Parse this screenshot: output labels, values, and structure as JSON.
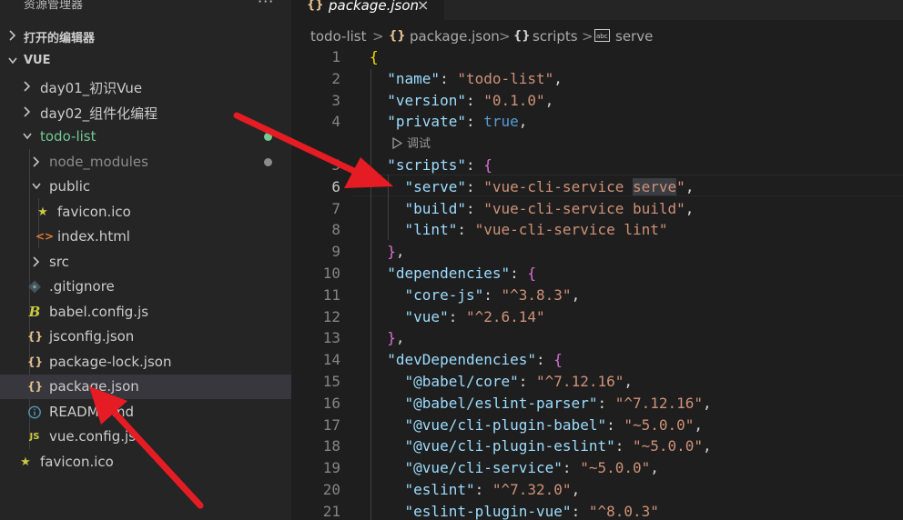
{
  "explorer": {
    "title": "资源管理器",
    "more_label": "···",
    "open_editors_label": "打开的编辑器",
    "workspace_label": "VUE"
  },
  "tree": [
    {
      "label": "day01_初识Vue",
      "icon": "chevron-right-icon",
      "kind": "folder"
    },
    {
      "label": "day02_组件化编程",
      "icon": "chevron-right-icon",
      "kind": "folder"
    },
    {
      "label": "todo-list",
      "icon": "chevron-down-icon",
      "kind": "folder",
      "color": "#73c991"
    },
    {
      "label": "node_modules",
      "icon": "chevron-right-icon",
      "kind": "folder",
      "color": "#8c8c8c"
    },
    {
      "label": "public",
      "icon": "chevron-down-icon",
      "kind": "folder"
    },
    {
      "label": "favicon.ico",
      "icon": "star-icon",
      "kind": "file"
    },
    {
      "label": "index.html",
      "icon": "html-icon",
      "kind": "file"
    },
    {
      "label": "src",
      "icon": "chevron-right-icon",
      "kind": "folder"
    },
    {
      "label": ".gitignore",
      "icon": "git-icon",
      "kind": "file"
    },
    {
      "label": "babel.config.js",
      "icon": "babel-icon",
      "kind": "file"
    },
    {
      "label": "jsconfig.json",
      "icon": "json-icon",
      "kind": "file"
    },
    {
      "label": "package-lock.json",
      "icon": "json-icon",
      "kind": "file"
    },
    {
      "label": "package.json",
      "icon": "json-icon",
      "kind": "file"
    },
    {
      "label": "README.md",
      "icon": "info-icon",
      "kind": "file"
    },
    {
      "label": "vue.config.js",
      "icon": "js-icon",
      "kind": "file"
    },
    {
      "label": "favicon.ico",
      "icon": "star-icon",
      "kind": "file"
    }
  ],
  "icons": {
    "json_glyph": "{}",
    "js_glyph": "JS",
    "babel_glyph": "B",
    "html_glyph": "<>",
    "info_glyph": "i",
    "star_glyph": "★"
  },
  "colors": {
    "json": "#e2c08d",
    "js": "#cbcb41",
    "html": "#e37933",
    "info": "#519aba",
    "star": "#cbcb41",
    "git": "#41535b",
    "modified_dot": "#73c991",
    "ignored_dot": "#8c8c8c",
    "annotation": "#e51c23"
  },
  "tab": {
    "name": "package.json",
    "close": "×"
  },
  "breadcrumb": {
    "root": "todo-list",
    "file": "package.json",
    "section": "scripts",
    "leaf": "serve",
    "sep": ">"
  },
  "codelens": "调试",
  "current_line": 6,
  "code_lines": [
    "{",
    "  \"name\": \"todo-list\",",
    "  \"version\": \"0.1.0\",",
    "  \"private\": true,",
    "  \"scripts\": {",
    "    \"serve\": \"vue-cli-service serve\",",
    "    \"build\": \"vue-cli-service build\",",
    "    \"lint\": \"vue-cli-service lint\"",
    "  },",
    "  \"dependencies\": {",
    "    \"core-js\": \"^3.8.3\",",
    "    \"vue\": \"^2.6.14\"",
    "  },",
    "  \"devDependencies\": {",
    "    \"@babel/core\": \"^7.12.16\",",
    "    \"@babel/eslint-parser\": \"^7.12.16\",",
    "    \"@vue/cli-plugin-babel\": \"~5.0.0\",",
    "    \"@vue/cli-plugin-eslint\": \"~5.0.0\",",
    "    \"@vue/cli-service\": \"~5.0.0\",",
    "    \"eslint\": \"^7.32.0\",",
    "    \"eslint-plugin-vue\": \"^8.0.3\""
  ]
}
